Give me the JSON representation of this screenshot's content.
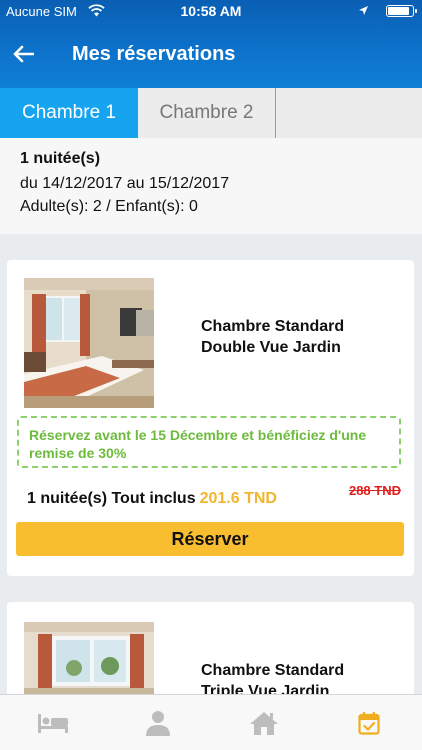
{
  "status_bar": {
    "carrier": "Aucune SIM",
    "time": "10:58 AM"
  },
  "header": {
    "title": "Mes réservations",
    "back_icon": "arrow-left-icon"
  },
  "tabs": [
    {
      "label": "Chambre 1",
      "active": true
    },
    {
      "label": "Chambre 2",
      "active": false
    }
  ],
  "summary": {
    "nights": "1 nuitée(s)",
    "dates": "du 14/12/2017 au 15/12/2017",
    "guests": "Adulte(s): 2 / Enfant(s): 0"
  },
  "offers": [
    {
      "room_line1": "Chambre Standard",
      "room_line2": "Double Vue Jardin",
      "promo": "Réservez avant le 15 Décembre et bénéficiez d'une remise de 30%",
      "price_label": "1 nuitée(s) Tout inclus",
      "price": "201.6 TND",
      "old_price": "288 TND",
      "button": "Réserver"
    },
    {
      "room_line1": "Chambre Standard",
      "room_line2": "Triple Vue Jardin"
    }
  ],
  "bottom_nav": [
    {
      "icon": "bed-icon",
      "active": false
    },
    {
      "icon": "user-icon",
      "active": false
    },
    {
      "icon": "home-icon",
      "active": false
    },
    {
      "icon": "calendar-check-icon",
      "active": true
    }
  ],
  "colors": {
    "header": "#0d71c9",
    "active_tab": "#16a3ef",
    "promo_green": "#6cbb3c",
    "price": "#f3b52e",
    "old_price": "#e0201f",
    "button": "#f9be2f",
    "active_nav": "#f0ad1f"
  }
}
